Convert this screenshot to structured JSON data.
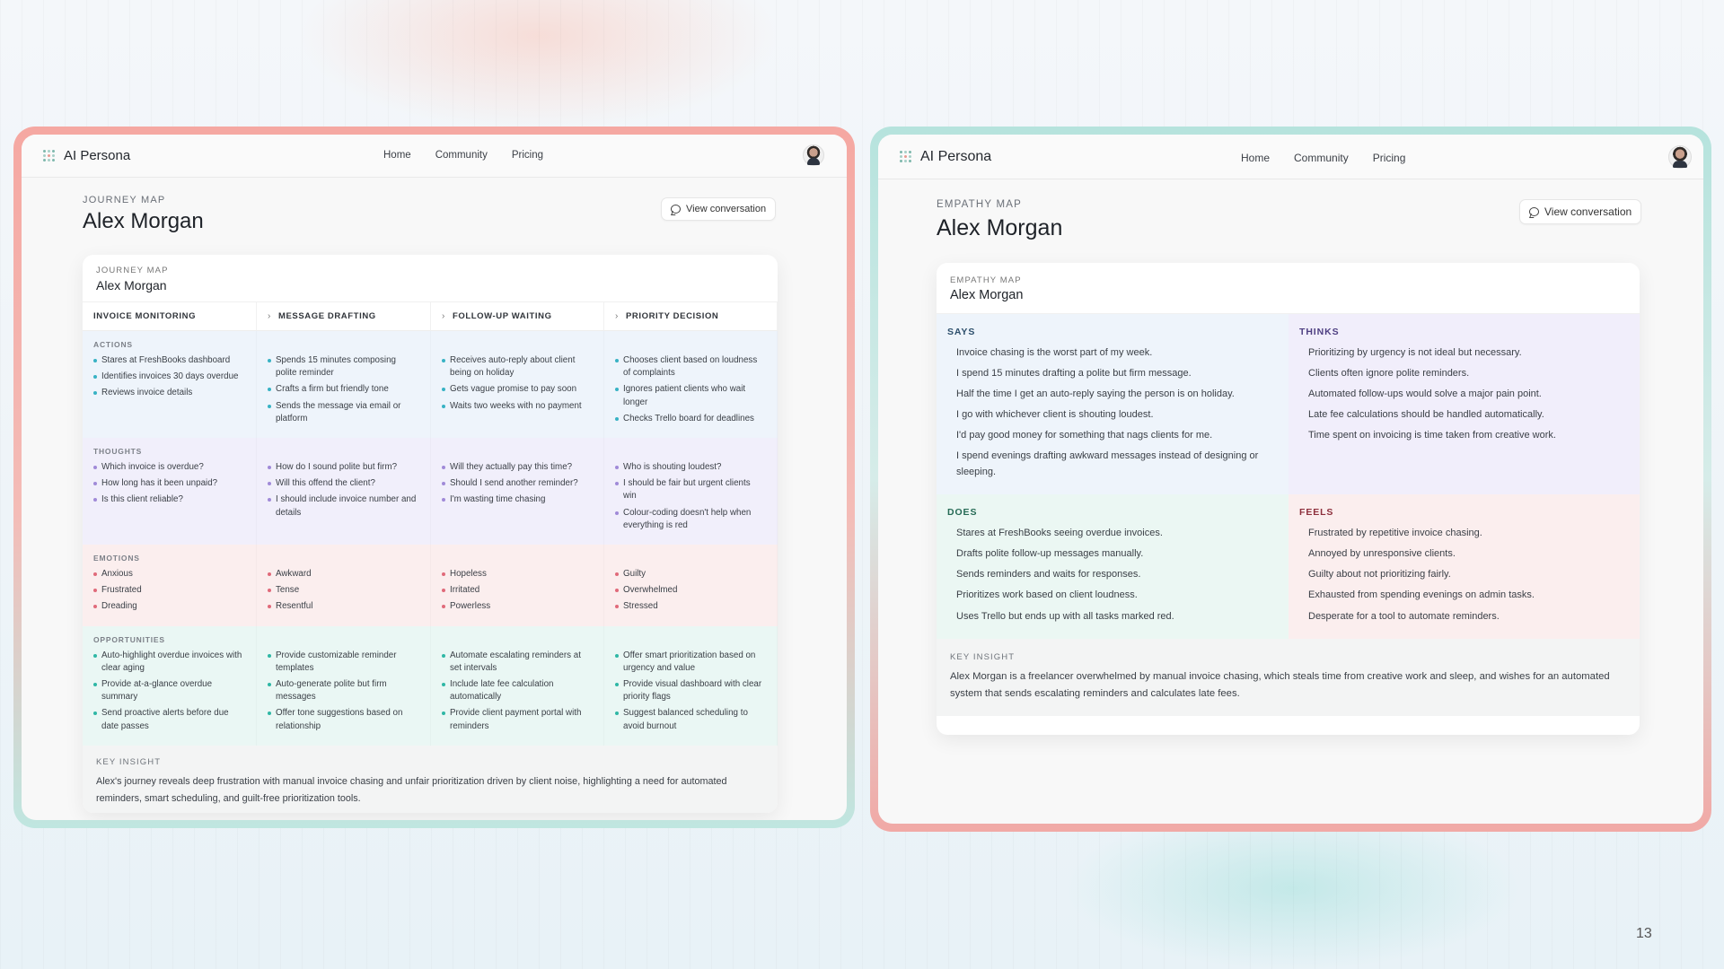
{
  "brand": "AI Persona",
  "nav": [
    "Home",
    "Community",
    "Pricing"
  ],
  "view_conversation": "View conversation",
  "page_number": "13",
  "journey": {
    "overline": "JOURNEY MAP",
    "name": "Alex Morgan",
    "card_overline": "JOURNEY MAP",
    "card_name": "Alex Morgan",
    "stages": [
      "INVOICE MONITORING",
      "MESSAGE DRAFTING",
      "FOLLOW-UP WAITING",
      "PRIORITY DECISION"
    ],
    "rows": [
      {
        "label": "ACTIONS",
        "cells": [
          [
            "Stares at FreshBooks dashboard",
            "Identifies invoices 30 days overdue",
            "Reviews invoice details"
          ],
          [
            "Spends 15 minutes composing polite reminder",
            "Crafts a firm but friendly tone",
            "Sends the message via email or platform"
          ],
          [
            "Receives auto-reply about client being on holiday",
            "Gets vague promise to pay soon",
            "Waits two weeks with no payment"
          ],
          [
            "Chooses client based on loudness of complaints",
            "Ignores patient clients who wait longer",
            "Checks Trello board for deadlines"
          ]
        ]
      },
      {
        "label": "THOUGHTS",
        "cells": [
          [
            "Which invoice is overdue?",
            "How long has it been unpaid?",
            "Is this client reliable?"
          ],
          [
            "How do I sound polite but firm?",
            "Will this offend the client?",
            "I should include invoice number and details"
          ],
          [
            "Will they actually pay this time?",
            "Should I send another reminder?",
            "I'm wasting time chasing"
          ],
          [
            "Who is shouting loudest?",
            "I should be fair but urgent clients win",
            "Colour-coding doesn't help when everything is red"
          ]
        ]
      },
      {
        "label": "EMOTIONS",
        "cells": [
          [
            "Anxious",
            "Frustrated",
            "Dreading"
          ],
          [
            "Awkward",
            "Tense",
            "Resentful"
          ],
          [
            "Hopeless",
            "Irritated",
            "Powerless"
          ],
          [
            "Guilty",
            "Overwhelmed",
            "Stressed"
          ]
        ]
      },
      {
        "label": "OPPORTUNITIES",
        "cells": [
          [
            "Auto-highlight overdue invoices with clear aging",
            "Provide at-a-glance overdue summary",
            "Send proactive alerts before due date passes"
          ],
          [
            "Provide customizable reminder templates",
            "Auto-generate polite but firm messages",
            "Offer tone suggestions based on relationship"
          ],
          [
            "Automate escalating reminders at set intervals",
            "Include late fee calculation automatically",
            "Provide client payment portal with reminders"
          ],
          [
            "Offer smart prioritization based on urgency and value",
            "Provide visual dashboard with clear priority flags",
            "Suggest balanced scheduling to avoid burnout"
          ]
        ]
      }
    ],
    "insight_label": "KEY INSIGHT",
    "insight": "Alex's journey reveals deep frustration with manual invoice chasing and unfair prioritization driven by client noise, highlighting a need for automated reminders, smart scheduling, and guilt-free prioritization tools."
  },
  "empathy": {
    "overline": "EMPATHY MAP",
    "name": "Alex Morgan",
    "card_overline": "EMPATHY MAP",
    "card_name": "Alex Morgan",
    "says": {
      "label": "SAYS",
      "items": [
        "Invoice chasing is the worst part of my week.",
        "I spend 15 minutes drafting a polite but firm message.",
        "Half the time I get an auto-reply saying the person is on holiday.",
        "I go with whichever client is shouting loudest.",
        "I'd pay good money for something that nags clients for me.",
        "I spend evenings drafting awkward messages instead of designing or sleeping."
      ]
    },
    "thinks": {
      "label": "THINKS",
      "items": [
        "Prioritizing by urgency is not ideal but necessary.",
        "Clients often ignore polite reminders.",
        "Automated follow-ups would solve a major pain point.",
        "Late fee calculations should be handled automatically.",
        "Time spent on invoicing is time taken from creative work."
      ]
    },
    "does": {
      "label": "DOES",
      "items": [
        "Stares at FreshBooks seeing overdue invoices.",
        "Drafts polite follow-up messages manually.",
        "Sends reminders and waits for responses.",
        "Prioritizes work based on client loudness.",
        "Uses Trello but ends up with all tasks marked red."
      ]
    },
    "feels": {
      "label": "FEELS",
      "items": [
        "Frustrated by repetitive invoice chasing.",
        "Annoyed by unresponsive clients.",
        "Guilty about not prioritizing fairly.",
        "Exhausted from spending evenings on admin tasks.",
        "Desperate for a tool to automate reminders."
      ]
    },
    "insight_label": "KEY INSIGHT",
    "insight": "Alex Morgan is a freelancer overwhelmed by manual invoice chasing, which steals time from creative work and sleep, and wishes for an automated system that sends escalating reminders and calculates late fees."
  }
}
